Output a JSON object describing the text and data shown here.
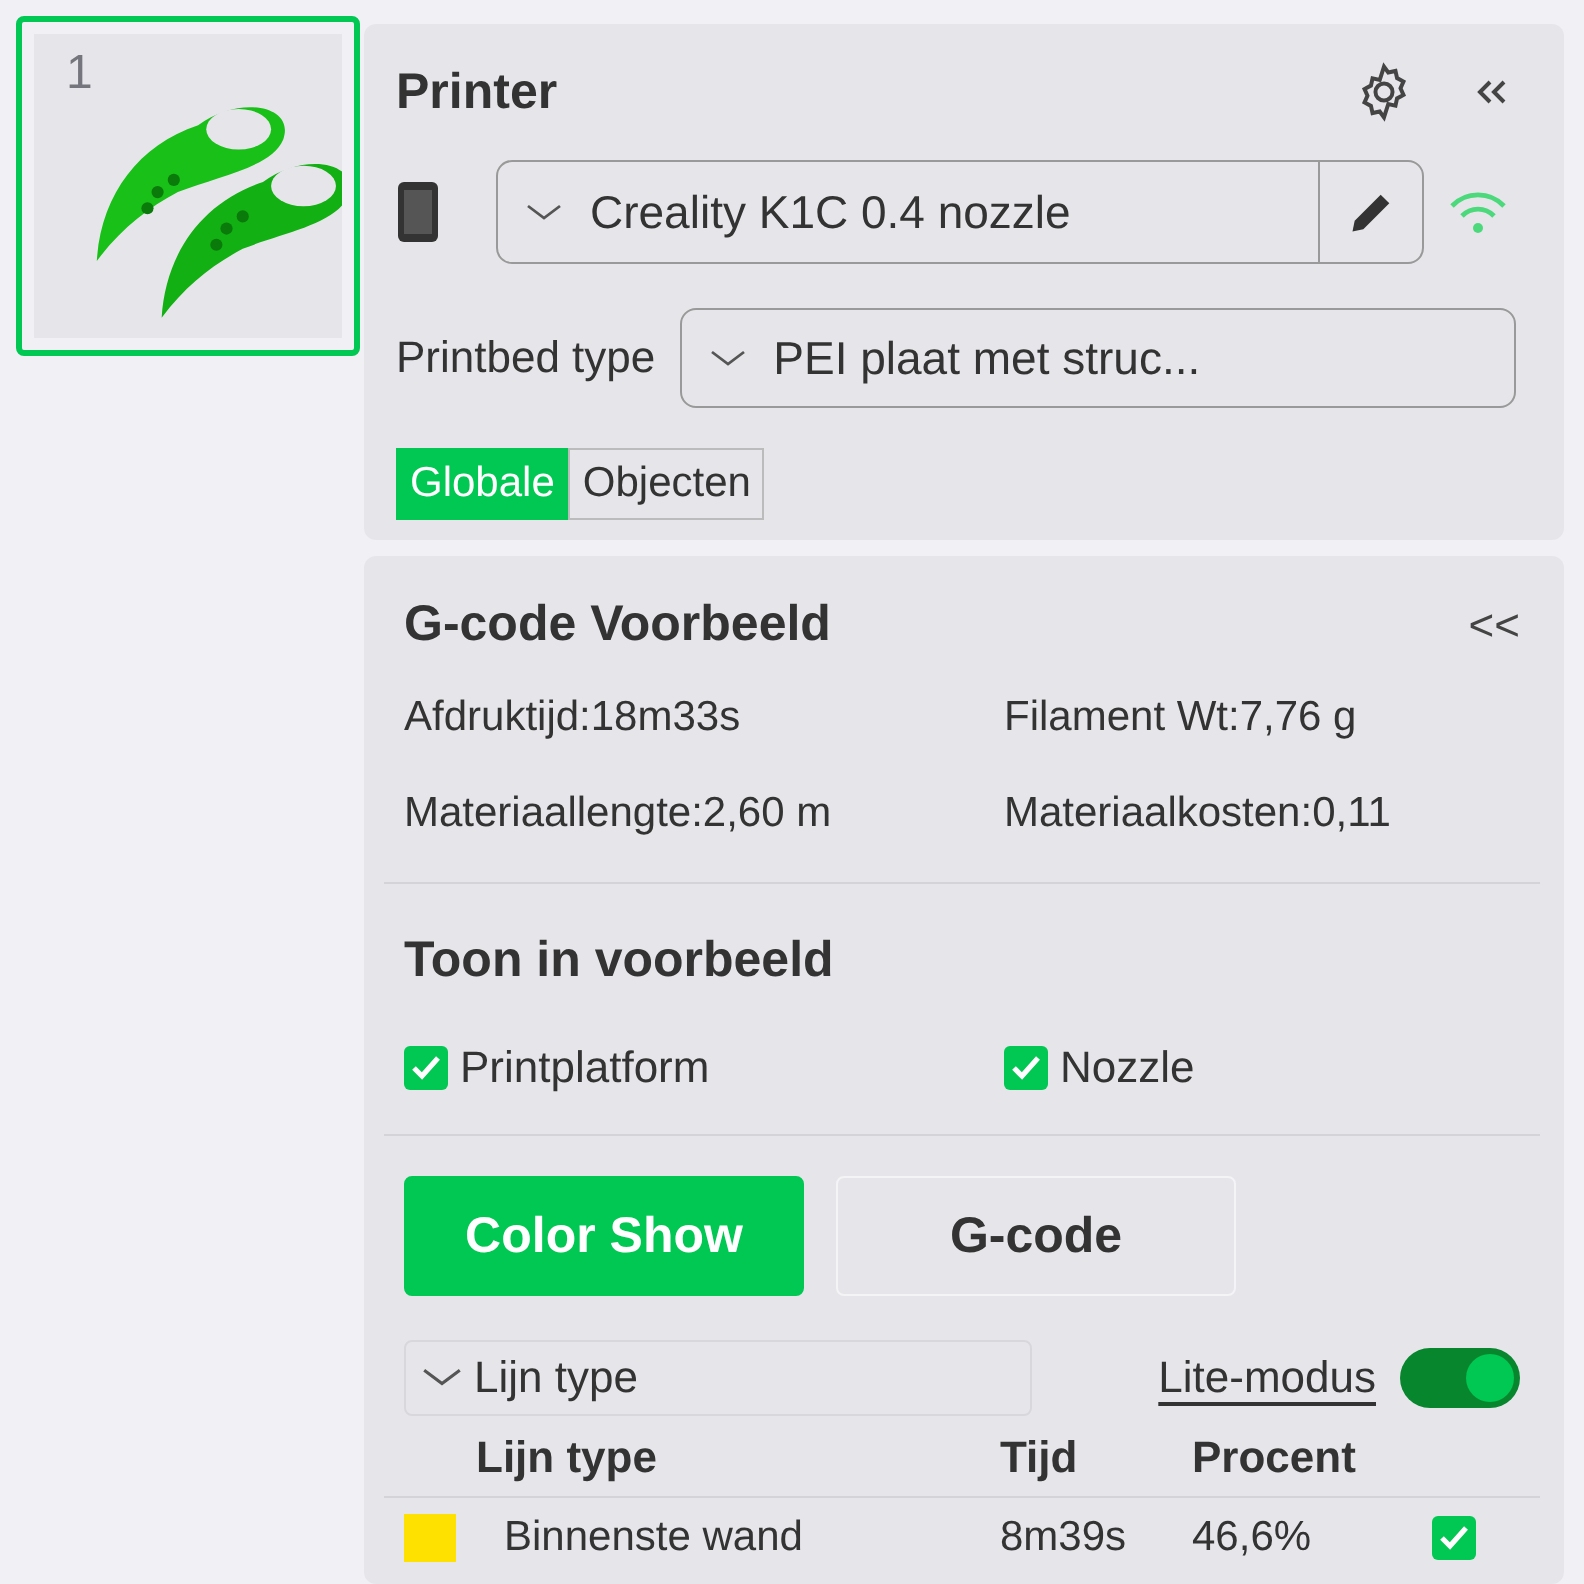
{
  "plate": {
    "number": "1",
    "selected": true
  },
  "printer": {
    "title": "Printer",
    "model": "Creality K1C 0.4 nozzle",
    "connected": true,
    "bed_label": "Printbed type",
    "bed_type": "PEI plaat met struc...",
    "tabs": [
      {
        "label": "Globale",
        "selected": true
      },
      {
        "label": "Objecten",
        "selected": false
      }
    ]
  },
  "preview": {
    "title": "G-code Voorbeeld",
    "collapse": "<<",
    "stats": [
      "Afdruktijd:18m33s",
      "Filament Wt:7,76 g",
      "Materiaallengte:2,60 m",
      "Materiaalkosten:0,11"
    ],
    "show_title": "Toon in voorbeeld",
    "show_options": [
      {
        "label": "Printplatform",
        "checked": true
      },
      {
        "label": "Nozzle",
        "checked": true
      }
    ],
    "modes": [
      {
        "label": "Color Show",
        "selected": true
      },
      {
        "label": "G-code",
        "selected": false
      }
    ],
    "view_type": "Lijn type",
    "lite_label": "Lite-modus",
    "lite_on": true,
    "columns": [
      "Lijn type",
      "Tijd",
      "Procent"
    ],
    "rows": [
      {
        "name": "Binnenste wand",
        "time": "8m39s",
        "percent": "46,6%",
        "color": "#ffe100",
        "visible": true
      }
    ]
  }
}
